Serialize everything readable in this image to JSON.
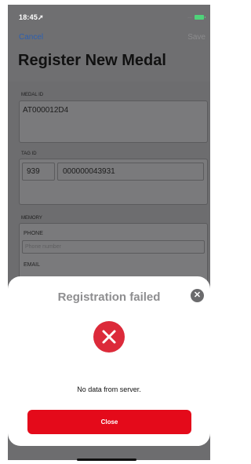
{
  "status_bar": {
    "time": "18:45",
    "signal": "...",
    "battery_color": "#4fd37a"
  },
  "nav": {
    "cancel_label": "Cancel",
    "save_label": "Save"
  },
  "page": {
    "title": "Register New Medal"
  },
  "form": {
    "medal_id": {
      "label": "MEDAL ID",
      "value": "AT000012D4"
    },
    "tag_id": {
      "label": "TAG ID",
      "prefix": "939",
      "value": "000000043931"
    },
    "memory": {
      "label": "MEMORY",
      "phone_label": "PHONE",
      "phone_placeholder": "Phone number",
      "email_label": "EMAIL"
    }
  },
  "modal": {
    "title": "Registration failed",
    "message": "No data from server.",
    "close_button_label": "Close",
    "error_color": "#dc2a3a",
    "button_color": "#e40a1a",
    "icons": {
      "close": "close-icon",
      "error": "error-x-icon"
    }
  }
}
